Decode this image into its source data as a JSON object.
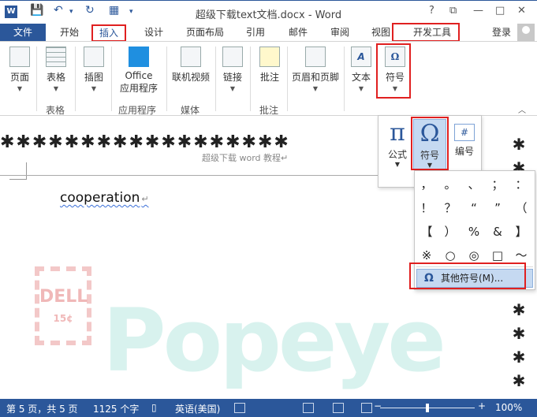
{
  "titlebar": {
    "app_icon": "W",
    "title": "超级下载text文档.docx - Word",
    "help": "?",
    "minimize": "—",
    "close": "✕"
  },
  "tabs": {
    "file": "文件",
    "items": [
      "开始",
      "插入",
      "设计",
      "页面布局",
      "引用",
      "邮件",
      "审阅",
      "视图",
      "开发工具"
    ],
    "active": "插入",
    "login": "登录"
  },
  "ribbon": {
    "buttons": {
      "page": "页面",
      "table": "表格",
      "picture": "插图",
      "office_apps": "Office\n应用程序",
      "office_line1": "Office",
      "office_line2": "应用程序",
      "online_video": "联机视频",
      "link": "链接",
      "comment": "批注",
      "header_footer": "页眉和页脚",
      "text": "文本",
      "symbol": "符号"
    },
    "groups": {
      "table": "表格",
      "apps": "应用程序",
      "media": "媒体",
      "comments": "批注"
    }
  },
  "symbol_panel": {
    "formula": "公式",
    "symbol": "符号",
    "numbering": "编号",
    "numbering_glyph": "#"
  },
  "symbol_grid": {
    "rows": [
      [
        "，",
        "。",
        "、",
        "；",
        "："
      ],
      [
        "！",
        "？",
        "“",
        "”",
        "（"
      ],
      [
        "【",
        "）",
        "%",
        "&",
        "】"
      ],
      [
        "※",
        "○",
        "◎",
        "□",
        "～"
      ]
    ],
    "more_label": "其他符号(M)...",
    "more_icon": "Ω"
  },
  "document": {
    "header_text": "超级下载 word 教程↵",
    "header_mark": "↵",
    "body_text": "cooperation",
    "paragraph_mark": "↵",
    "stars": "✱✱✱✱✱✱✱✱✱✱✱✱✱✱✱✱✱✱"
  },
  "statusbar": {
    "page": "第 5 页，共 5 页",
    "words": "1125 个字",
    "language": "英语(美国)",
    "zoom": "100%"
  },
  "colors": {
    "accent": "#2b579a",
    "highlight_red": "#e02020",
    "hover_blue": "#c5d9f1"
  }
}
